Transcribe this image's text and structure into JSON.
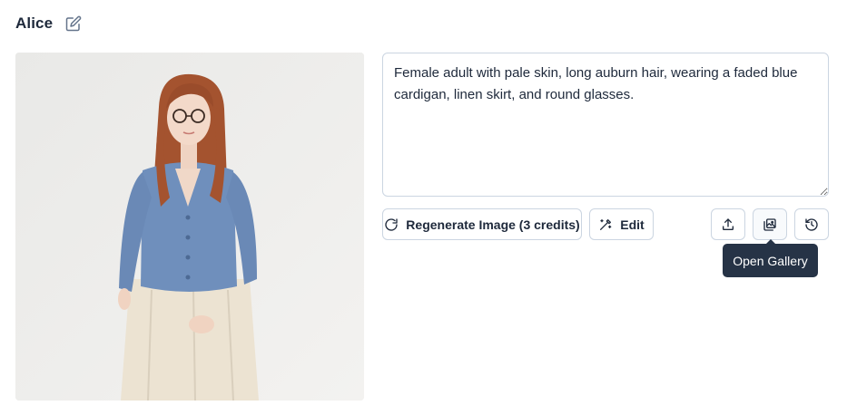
{
  "character": {
    "name": "Alice",
    "description": "Female adult with pale skin, long auburn hair, wearing a faded blue cardigan, linen skirt, and round glasses."
  },
  "toolbar": {
    "regenerate_label": "Regenerate Image (3 credits)",
    "edit_label": "Edit",
    "upload_icon": "upload-icon",
    "gallery_icon": "gallery-icon",
    "history_icon": "history-icon"
  },
  "tooltip": {
    "text": "Open Gallery"
  }
}
